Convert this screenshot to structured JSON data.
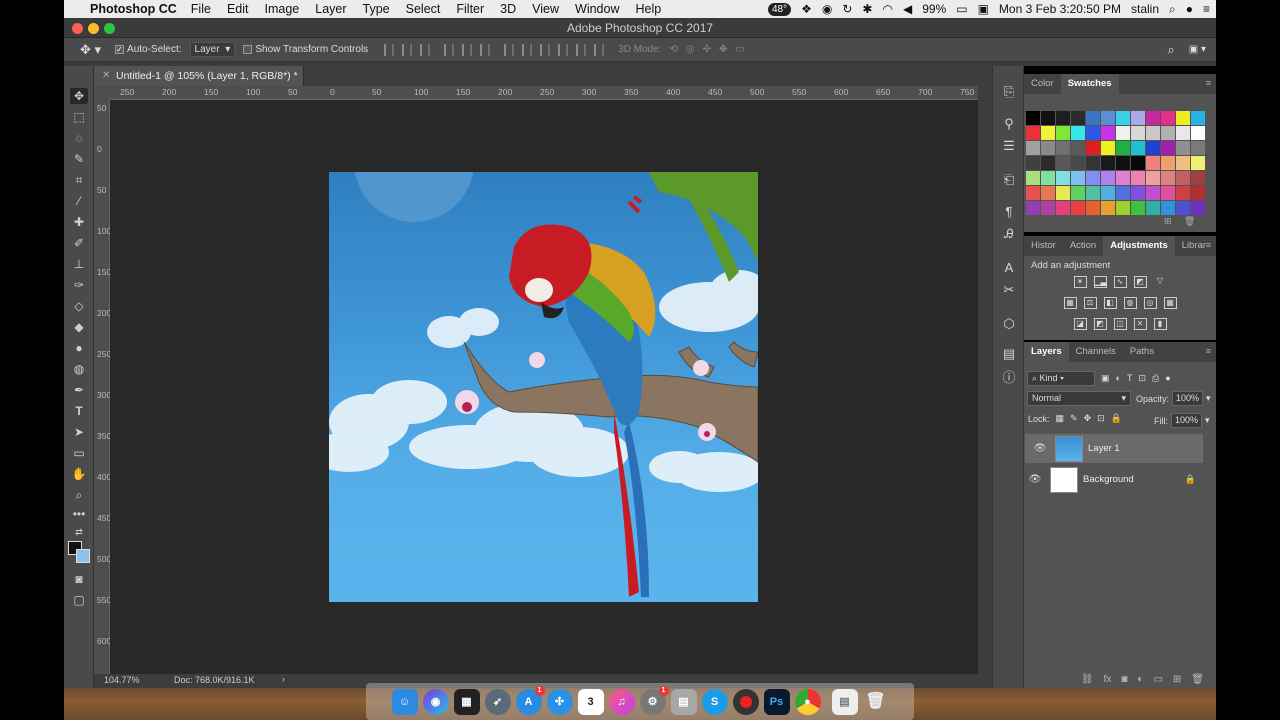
{
  "menubar": {
    "app_name": "Photoshop CC",
    "items": [
      "File",
      "Edit",
      "Image",
      "Layer",
      "Type",
      "Select",
      "Filter",
      "3D",
      "View",
      "Window",
      "Help"
    ],
    "battery_temp": "48°",
    "battery": "99%",
    "clock": "Mon 3 Feb  3:20:50 PM",
    "user": "stalin"
  },
  "window": {
    "title": "Adobe Photoshop CC 2017"
  },
  "options": {
    "auto_select_label": "Auto-Select:",
    "auto_select_value": "Layer",
    "transform_label": "Show Transform Controls",
    "mode_3d_label": "3D Mode:"
  },
  "document": {
    "tab_title": "Untitled-1 @ 105% (Layer 1, RGB/8*) *",
    "zoom_status": "104.77%",
    "doc_status": "Doc: 768.0K/916.1K"
  },
  "ruler": {
    "h_labels": [
      "250",
      "200",
      "150",
      "100",
      "50",
      "0",
      "50",
      "100",
      "150",
      "200",
      "250",
      "300",
      "350",
      "400",
      "450",
      "500",
      "550",
      "600",
      "650",
      "700",
      "750"
    ],
    "v_labels": [
      "50",
      "0",
      "50",
      "100",
      "150",
      "200",
      "250",
      "300",
      "350",
      "400",
      "450",
      "500",
      "550",
      "600"
    ]
  },
  "color_panel": {
    "tabs": [
      "Color",
      "Swatches"
    ],
    "active_tab": "Swatches",
    "swatches": [
      "#000000",
      "#111111",
      "#1e1e1e",
      "#2b2b2b",
      "#3a76c4",
      "#5a8fd8",
      "#39d0e8",
      "#a9a9e8",
      "#c42aa0",
      "#e62e8c",
      "#ecec20",
      "#2ab0e8",
      "#e8323a",
      "#f2f23a",
      "#7ee83a",
      "#32e8e8",
      "#3255e8",
      "#c832e8",
      "#f0f0f0",
      "#d8d8d8",
      "#c8c8c8",
      "#b0b0b0",
      "#e8e8e8",
      "#ffffff",
      "#a0a0a0",
      "#8a8a8a",
      "#707070",
      "#5a5a5a",
      "#e02020",
      "#f0f020",
      "#20b040",
      "#20c0d0",
      "#2040d0",
      "#a020b0",
      "#909090",
      "#7a7a7a",
      "#404040",
      "#2a2a2a",
      "#585858",
      "#484848",
      "#343434",
      "#1a1a1a",
      "#101010",
      "#080808",
      "#f08080",
      "#f0a070",
      "#f0c080",
      "#f0f070",
      "#a8e080",
      "#80e0a0",
      "#80e0e0",
      "#80c0f0",
      "#8090f0",
      "#b080f0",
      "#e080d0",
      "#f080b0",
      "#f0a0a0",
      "#e08080",
      "#c06060",
      "#a04040",
      "#e85050",
      "#e87850",
      "#e8e850",
      "#60d060",
      "#50c0a0",
      "#50b0e0",
      "#5070e0",
      "#8050e0",
      "#c050d0",
      "#e050a0",
      "#d04040",
      "#b03030",
      "#9040b0",
      "#b040a0",
      "#e04080",
      "#e84040",
      "#e86030",
      "#e8a030",
      "#a0d030",
      "#40c040",
      "#30b0a0",
      "#3090e0",
      "#5050d0",
      "#7030c0"
    ]
  },
  "adjust_panel": {
    "tabs": [
      "Histor",
      "Action",
      "Adjustments",
      "Librar"
    ],
    "active_tab": "Adjustments",
    "heading": "Add an adjustment"
  },
  "layers_panel": {
    "tabs": [
      "Layers",
      "Channels",
      "Paths"
    ],
    "active_tab": "Layers",
    "filter_label": "Kind",
    "blend_mode": "Normal",
    "opacity_label": "Opacity:",
    "opacity_value": "100%",
    "lock_label": "Lock:",
    "fill_label": "Fill:",
    "fill_value": "100%",
    "layers": [
      {
        "name": "Layer 1",
        "selected": true,
        "locked": false
      },
      {
        "name": "Background",
        "selected": false,
        "locked": true
      }
    ]
  },
  "dock": {
    "calendar_day": "3",
    "appstore_badge": "1",
    "prefs_badge": "1"
  }
}
